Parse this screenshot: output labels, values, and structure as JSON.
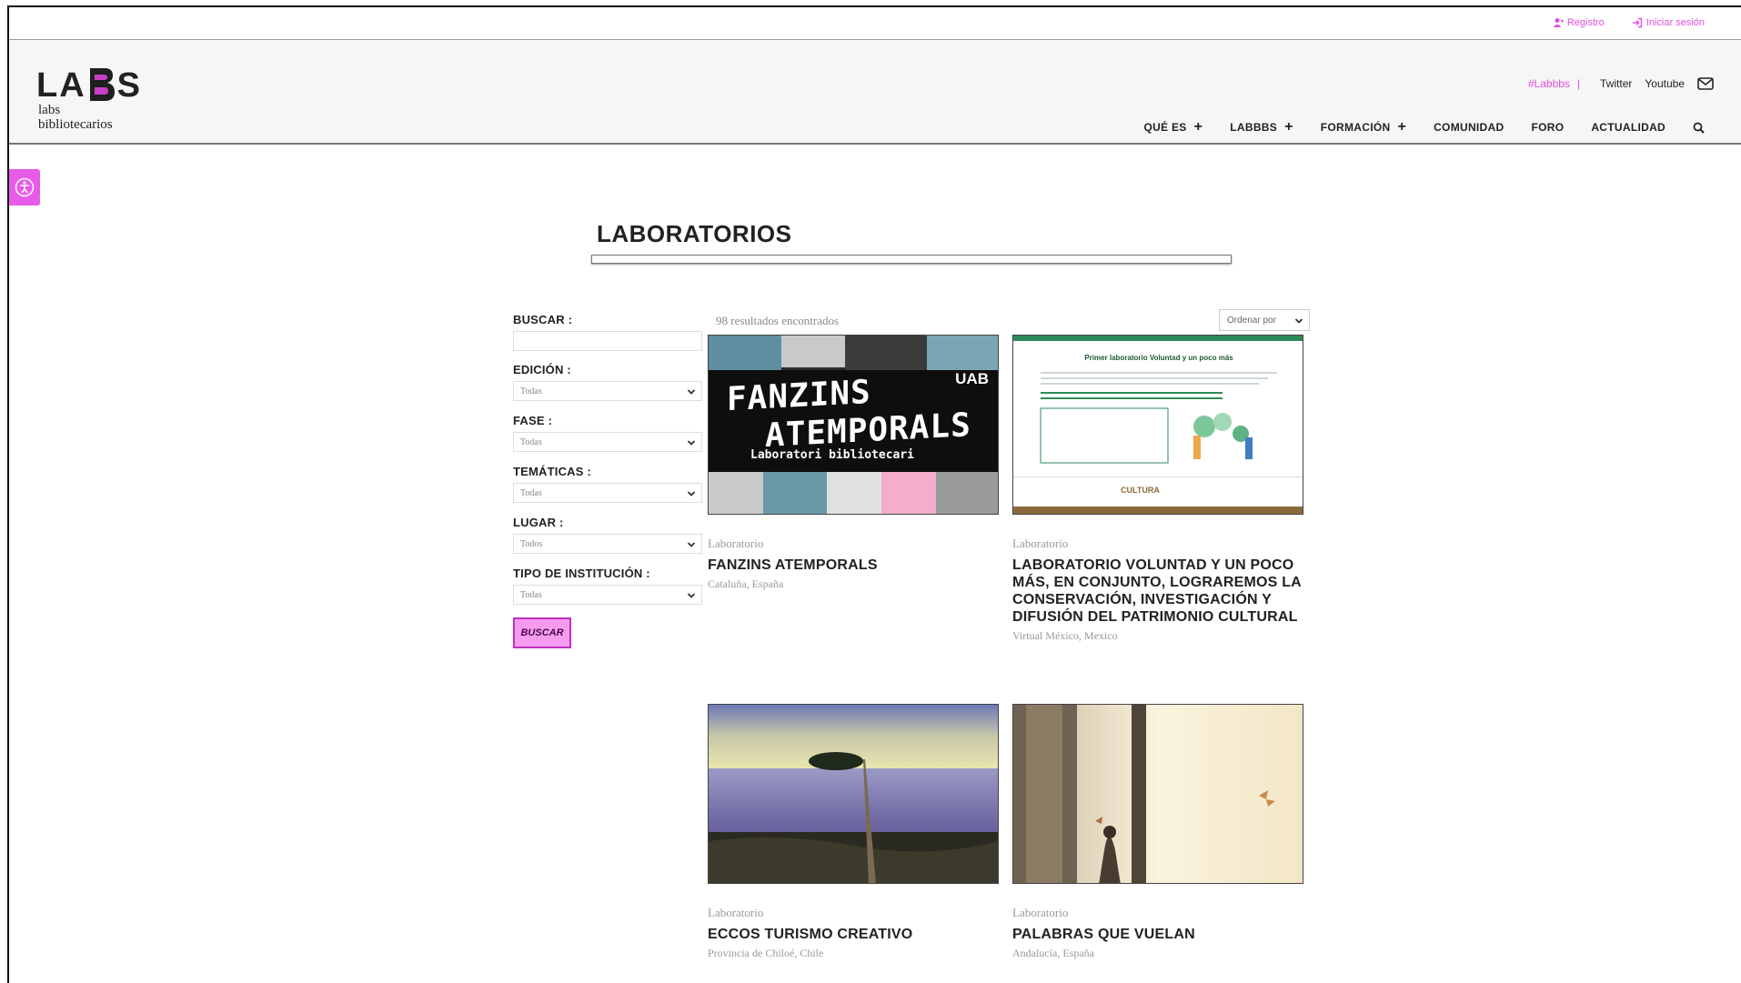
{
  "topbar": {
    "register": "Registro",
    "login": "Iniciar sesión"
  },
  "logo": {
    "mark_left": "LA",
    "mark_right": "S",
    "sub_line1": "labs",
    "sub_line2": "bibliotecarios"
  },
  "social": {
    "hashtag": "#Labbbs",
    "separator": "|",
    "twitter": "Twitter",
    "youtube": "Youtube"
  },
  "nav": {
    "items": [
      "QUÉ ES",
      "LABBBS",
      "FORMACIÓN",
      "COMUNIDAD",
      "FORO",
      "ACTUALIDAD"
    ],
    "expand_symbol": "+"
  },
  "page": {
    "title": "LABORATORIOS"
  },
  "filters": {
    "search_label": "BUSCAR :",
    "edicion_label": "EDICIÓN :",
    "edicion_value": "Todas",
    "fase_label": "FASE :",
    "fase_value": "Todas",
    "tematicas_label": "TEMÁTICAS :",
    "tematicas_value": "Todas",
    "lugar_label": "LUGAR :",
    "lugar_value": "Todos",
    "tipo_label": "TIPO DE INSTITUCIÓN :",
    "tipo_value": "Todas",
    "submit": "BUSCAR"
  },
  "results": {
    "count_text": "98 resultados encontrados",
    "sort_label": "Ordenar por"
  },
  "cards": [
    {
      "type": "Laboratorio",
      "title": "FANZINS ATEMPORALS",
      "location": "Cataluña, España",
      "thumb": {
        "line1": "FANZINS",
        "line2": "ATEMPORALS",
        "line3": "Laboratori bibliotecari",
        "badge": "UAB"
      }
    },
    {
      "type": "Laboratorio",
      "title": "LABORATORIO VOLUNTAD Y UN POCO MÁS, EN CONJUNTO, LOGRAREMOS LA CONSERVACIÓN, INVESTIGACIÓN Y DIFUSIÓN DEL PATRIMONIO CULTURAL",
      "location": "Virtual México, Mexico",
      "thumb": {
        "heading": "Primer laboratorio Voluntad y un poco más",
        "footer": "CULTURA"
      }
    },
    {
      "type": "Laboratorio",
      "title": "ECCOS TURISMO CREATIVO",
      "location": "Provincia de Chiloé, Chile"
    },
    {
      "type": "Laboratorio",
      "title": "PALABRAS QUE VUELAN",
      "location": "Andalucía, España"
    }
  ],
  "colors": {
    "accent": "#e14fe0",
    "button": "#f69cf0"
  }
}
